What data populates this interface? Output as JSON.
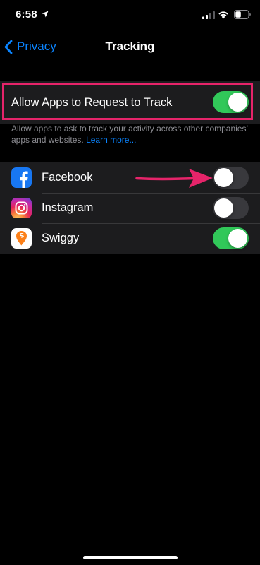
{
  "status_bar": {
    "time": "6:58"
  },
  "nav": {
    "back_label": "Privacy",
    "title": "Tracking"
  },
  "tracking": {
    "allow_label": "Allow Apps to Request to Track",
    "allow_enabled": true,
    "footer_text": "Allow apps to ask to track your activity across other companies’ apps and websites.",
    "learn_more": "Learn more..."
  },
  "apps": [
    {
      "name": "Facebook",
      "enabled": false,
      "icon": "facebook-icon"
    },
    {
      "name": "Instagram",
      "enabled": false,
      "icon": "instagram-icon"
    },
    {
      "name": "Swiggy",
      "enabled": true,
      "icon": "swiggy-icon"
    }
  ],
  "colors": {
    "accent_blue": "#0a84ff",
    "toggle_on": "#31c859",
    "toggle_off": "#39393d",
    "highlight": "#e6246a"
  }
}
